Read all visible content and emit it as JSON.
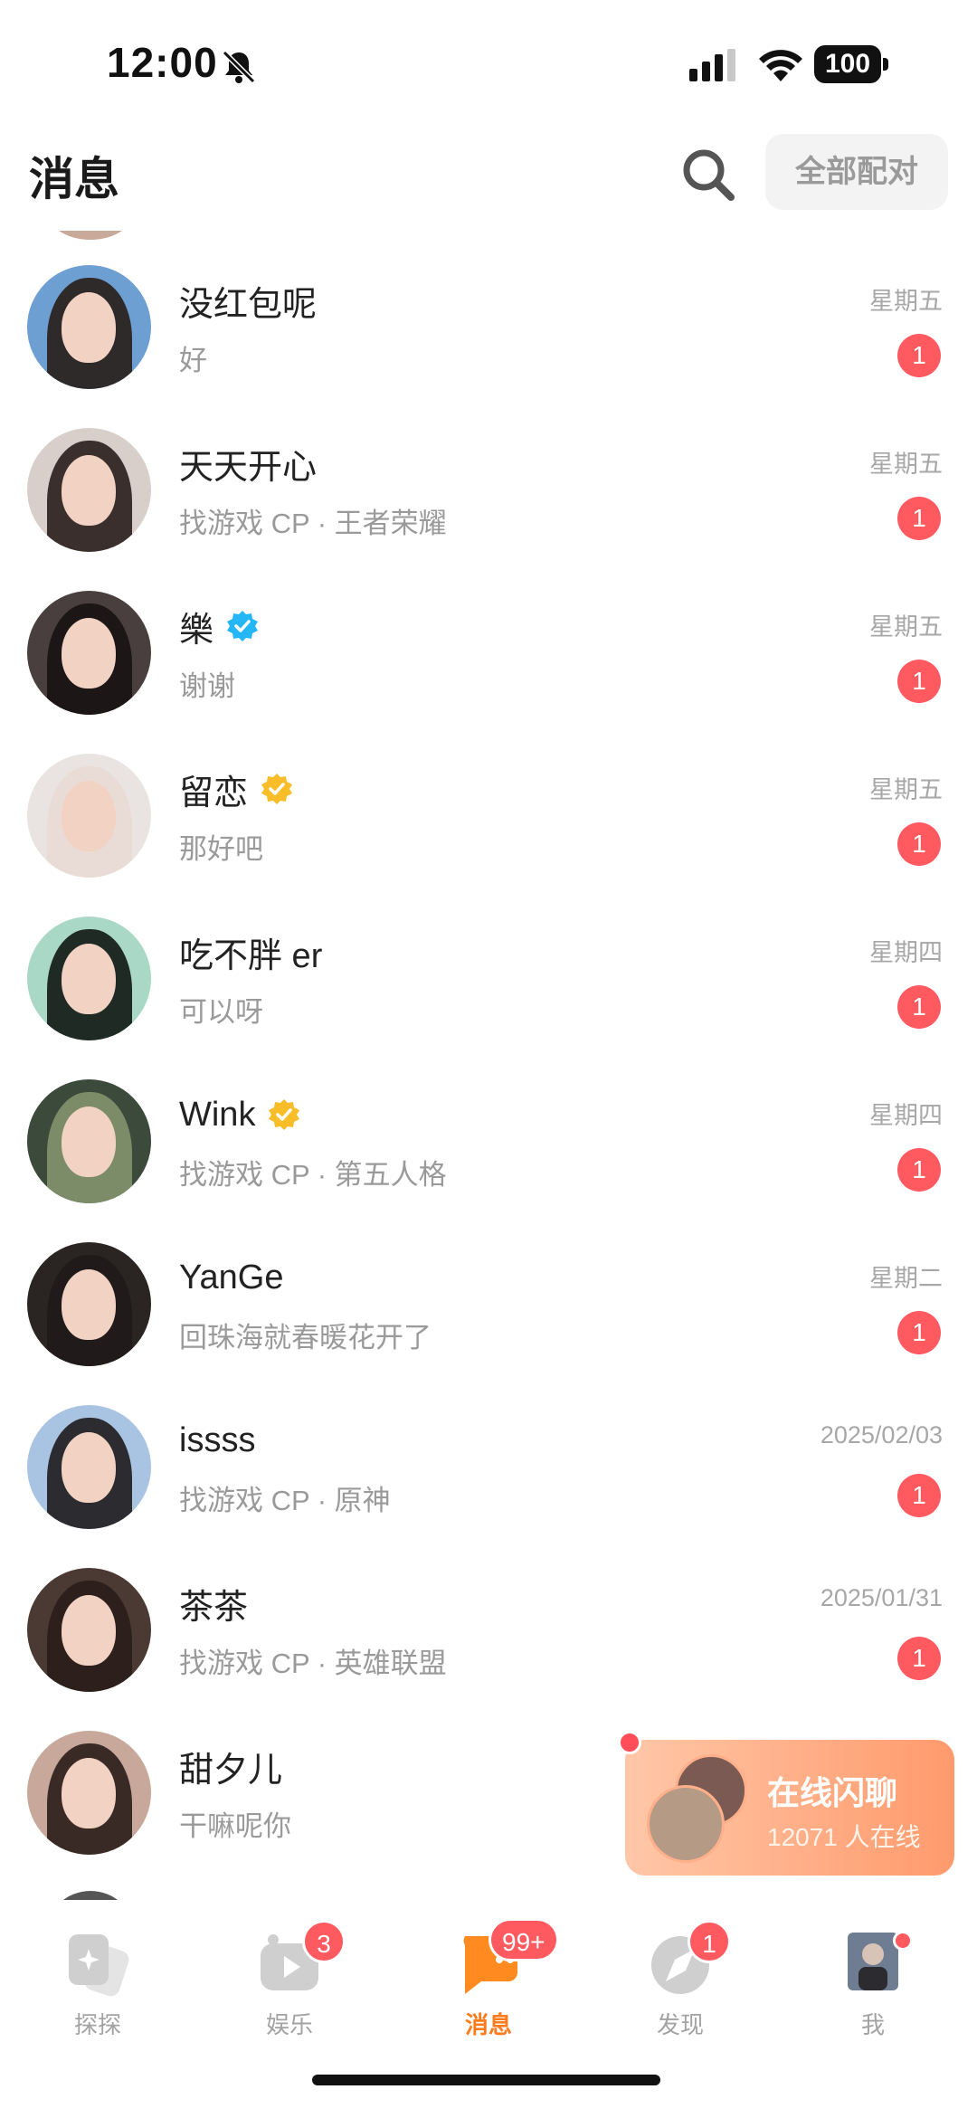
{
  "status": {
    "time": "12:00",
    "battery": "100"
  },
  "header": {
    "title": "消息",
    "match_all_label": "全部配对"
  },
  "conversations": [
    {
      "name": "没红包呢",
      "preview": "好",
      "time": "星期五",
      "unread": "1",
      "verified": "none",
      "hair": "#2f2a2a",
      "bg": "#6d9fd2"
    },
    {
      "name": "天天开心",
      "preview": "找游戏 CP · 王者荣耀",
      "time": "星期五",
      "unread": "1",
      "verified": "none",
      "hair": "#3a2f2c",
      "bg": "#d8cfcb"
    },
    {
      "name": "樂",
      "preview": "谢谢",
      "time": "星期五",
      "unread": "1",
      "verified": "blue",
      "hair": "#1d1616",
      "bg": "#4a3f3f"
    },
    {
      "name": "留恋",
      "preview": "那好吧",
      "time": "星期五",
      "unread": "1",
      "verified": "gold",
      "hair": "#e9dcd6",
      "bg": "#e9e4e2"
    },
    {
      "name": "吃不胖 er",
      "preview": "可以呀",
      "time": "星期四",
      "unread": "1",
      "verified": "none",
      "hair": "#1f2a25",
      "bg": "#a9d8c6"
    },
    {
      "name": "Wink",
      "preview": "找游戏 CP · 第五人格",
      "time": "星期四",
      "unread": "1",
      "verified": "gold",
      "hair": "#7d8c68",
      "bg": "#3c4a3c"
    },
    {
      "name": "YanGe",
      "preview": "回珠海就春暖花开了",
      "time": "星期二",
      "unread": "1",
      "verified": "none",
      "hair": "#201b1a",
      "bg": "#2a2523"
    },
    {
      "name": "issss",
      "preview": "找游戏 CP · 原神",
      "time": "2025/02/03",
      "unread": "1",
      "verified": "none",
      "hair": "#2b2b30",
      "bg": "#a9c3e3"
    },
    {
      "name": "茶茶",
      "preview": "找游戏 CP · 英雄联盟",
      "time": "2025/01/31",
      "unread": "1",
      "verified": "none",
      "hair": "#2d201c",
      "bg": "#4a3a33"
    },
    {
      "name": "甜夕儿",
      "preview": "干嘛呢你",
      "time": "",
      "unread": "",
      "verified": "none",
      "hair": "#3a2a25",
      "bg": "#c7a89a"
    }
  ],
  "flash_chat": {
    "title": "在线闪聊",
    "subtitle": "12071 人在线"
  },
  "tabs": [
    {
      "label": "探探",
      "badge": "",
      "active": false
    },
    {
      "label": "娱乐",
      "badge": "3",
      "active": false
    },
    {
      "label": "消息",
      "badge": "99+",
      "active": true
    },
    {
      "label": "发现",
      "badge": "1",
      "active": false
    },
    {
      "label": "我",
      "badge": "",
      "active": false
    }
  ],
  "colors": {
    "accent": "#ff7a1a",
    "badge": "#ff5a5f",
    "verified_blue": "#25b6f5",
    "verified_gold": "#f8be2a"
  }
}
